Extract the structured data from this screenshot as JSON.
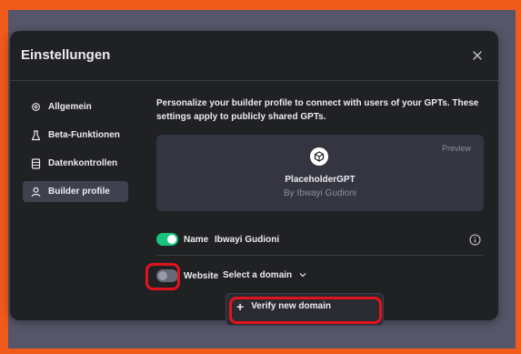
{
  "dialog": {
    "title": "Einstellungen"
  },
  "sidebar": {
    "items": [
      {
        "label": "Allgemein",
        "icon": "gear-icon",
        "active": false
      },
      {
        "label": "Beta-Funktionen",
        "icon": "flask-icon",
        "active": false
      },
      {
        "label": "Datenkontrollen",
        "icon": "database-icon",
        "active": false
      },
      {
        "label": "Builder profile",
        "icon": "user-icon",
        "active": true
      }
    ]
  },
  "builder_profile": {
    "description": "Personalize your builder profile to connect with users of your GPTs. These settings apply to publicly shared GPTs.",
    "preview": {
      "label": "Preview",
      "gpt_name": "PlaceholderGPT",
      "by_line": "By Ibwayi Gudioni"
    },
    "name_field": {
      "label": "Name",
      "value": "Ibwayi Gudioni",
      "enabled": true
    },
    "website_field": {
      "label": "Website",
      "select_value": "Select a domain",
      "enabled": false
    },
    "dropdown": {
      "items": [
        {
          "label": "Verify new domain"
        }
      ]
    }
  },
  "colors": {
    "accent_green": "#19c37d",
    "highlight_red": "#e0141e",
    "frame_orange": "#f05a1a"
  }
}
